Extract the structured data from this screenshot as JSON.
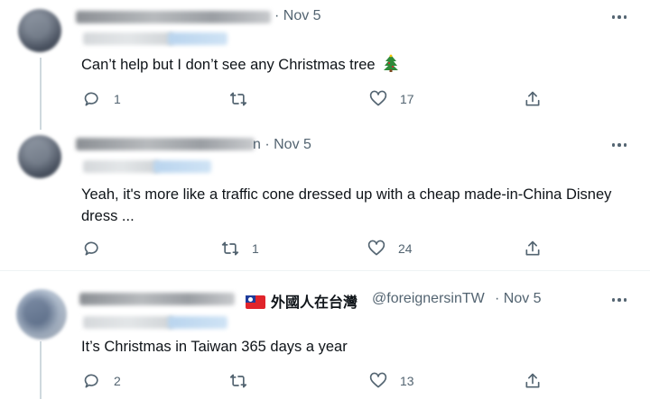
{
  "tweets": [
    {
      "date": "· Nov 5",
      "text": "Can’t help but I don’t see any Christmas tree",
      "emoji": "christmas-tree",
      "replies": "1",
      "retweets": "",
      "likes": "17"
    },
    {
      "date": "n · Nov 5",
      "text": "Yeah, it's more like a traffic cone dressed up with a cheap made-in-China Disney dress ...",
      "replies": "",
      "retweets": "1",
      "likes": "24"
    },
    {
      "display_name": "外國人在台灣",
      "handle": "@foreignersinTW",
      "date": "· Nov 5",
      "text": "It’s Christmas in Taiwan 365 days a year",
      "replies": "2",
      "retweets": "",
      "likes": "13"
    }
  ],
  "icons": {
    "reply": "reply-icon",
    "retweet": "retweet-icon",
    "like": "heart-icon",
    "share": "share-icon",
    "more": "more-icon",
    "flag": "taiwan-flag-icon"
  },
  "colors": {
    "text": "#0f1419",
    "secondary": "#536471",
    "divider": "#eff3f4",
    "thread_line": "#cfd9de"
  }
}
